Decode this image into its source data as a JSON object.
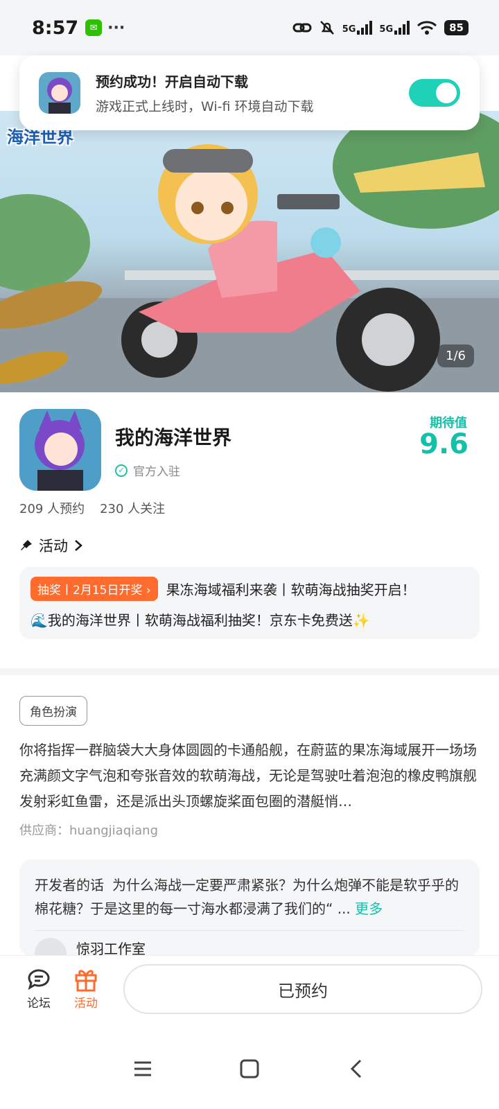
{
  "status_bar": {
    "time": "8:57",
    "more": "···",
    "signal1": "5G",
    "signal2": "5G",
    "battery": "85"
  },
  "toast": {
    "title": "预约成功！开启自动下载",
    "subtitle": "游戏正式上线时，Wi-fi 环境自动下载",
    "toggle_on": true
  },
  "banner": {
    "logo_text": "海洋世界",
    "counter": "1/6"
  },
  "app": {
    "name": "我的海洋世界",
    "official": "官方入驻",
    "expect_label": "期待值",
    "expect_value": "9.6",
    "reservations": "209 人预约",
    "followers": "230 人关注"
  },
  "activity": {
    "header": "活动",
    "badge": "抽奖丨2月15日开奖 ›",
    "line1": "果冻海域福利来袭丨软萌海战抽奖开启！",
    "line2": "🌊我的海洋世界丨软萌海战福利抽奖！京东卡免费送✨"
  },
  "details": {
    "tag": "角色扮演",
    "description": "你将指挥一群脑袋大大身体圆圆的卡通船舰，在蔚蓝的果冻海域展开一场场充满颜文字气泡和夸张音效的软萌海战，无论是驾驶吐着泡泡的橡皮鸭旗舰发射彩虹鱼雷，还是派出头顶螺旋桨面包圈的潜艇悄…",
    "supplier": "供应商：huangjiaqiang"
  },
  "developer": {
    "label": "开发者的话",
    "text": "为什么海战一定要严肃紧张？为什么炮弹不能是软乎乎的棉花糖？于是这里的每一寸海水都浸满了我们的“ ... ",
    "more": "更多",
    "author": "惊羽工作室"
  },
  "bottom": {
    "forum": "论坛",
    "activity": "活动",
    "reserved": "已预约"
  },
  "colors": {
    "accent": "#13c1a9",
    "orange": "#ff6a2d"
  }
}
